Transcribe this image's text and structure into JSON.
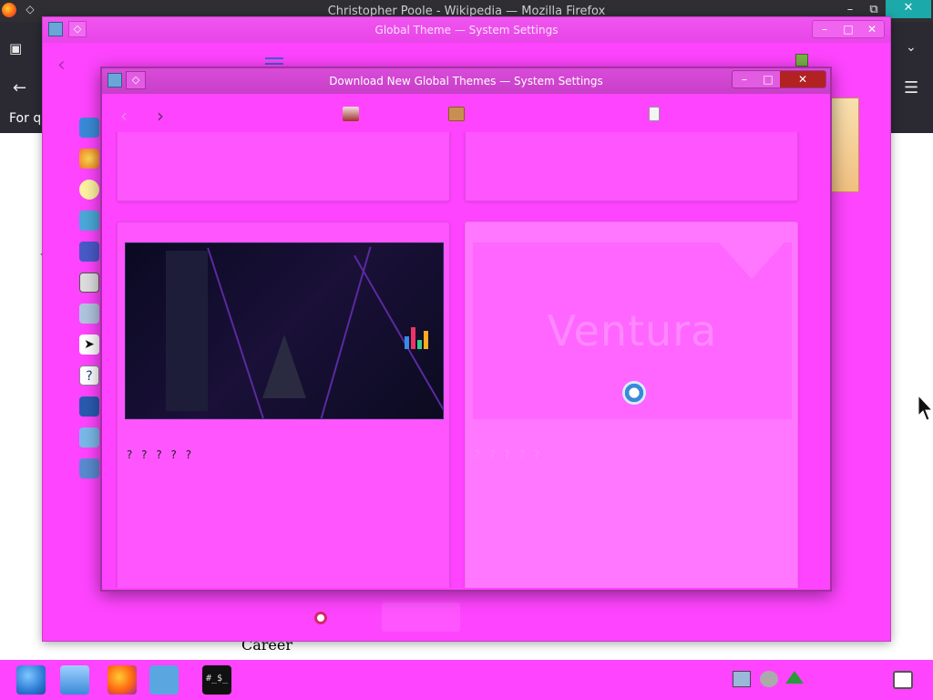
{
  "firefox": {
    "title": "Christopher Poole - Wikipedia — Mozilla Firefox",
    "snippet": "For qu",
    "career": "Career"
  },
  "global_theme": {
    "title": "Global Theme — System Settings"
  },
  "dialog": {
    "title": "Download New Global Themes — System Settings",
    "tiles": [
      {
        "name": "? ? ? ? ?"
      },
      {
        "brand": "Ventura",
        "name": "? ? ? ? ?"
      }
    ]
  },
  "terminal_label": "#_$_",
  "colors": {
    "accent": "#ff44ff",
    "dialog_border": "#a52fa5",
    "close_red": "#b22222"
  }
}
